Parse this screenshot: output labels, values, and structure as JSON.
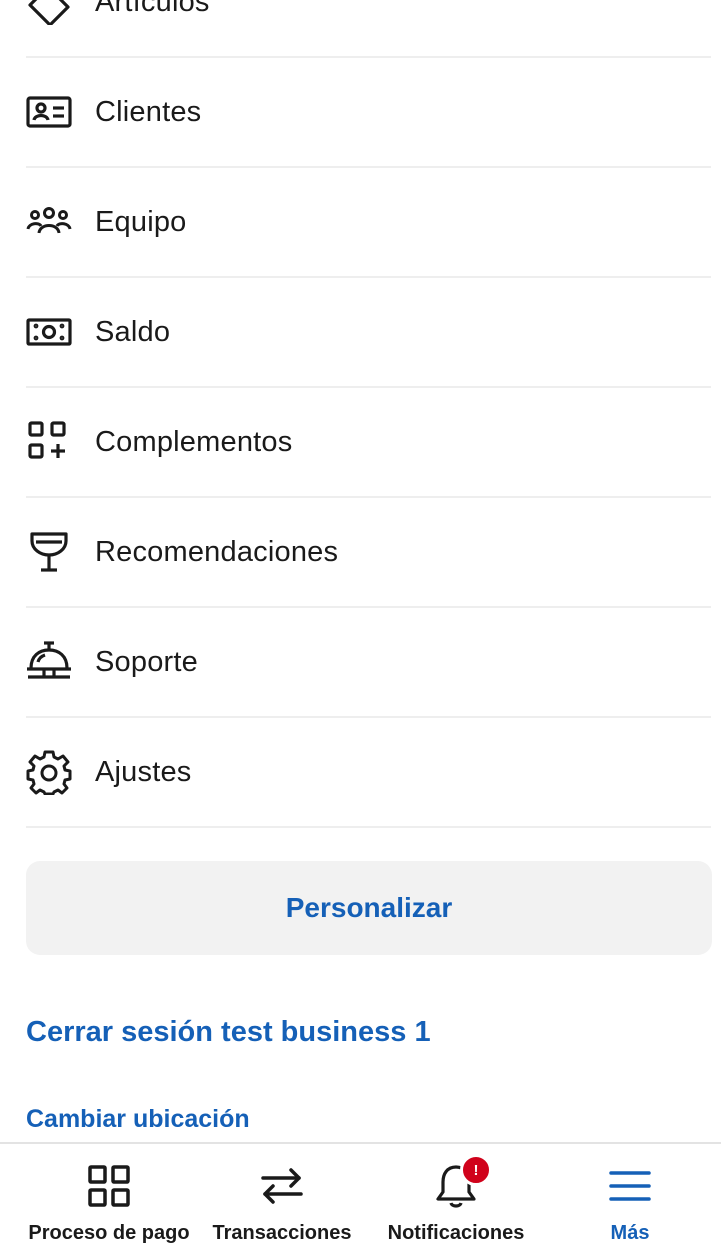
{
  "menu": {
    "items": [
      {
        "label": "Artículos",
        "icon": "tag-icon"
      },
      {
        "label": "Clientes",
        "icon": "contact-card-icon"
      },
      {
        "label": "Equipo",
        "icon": "team-icon"
      },
      {
        "label": "Saldo",
        "icon": "banknote-icon"
      },
      {
        "label": "Complementos",
        "icon": "add-ons-icon"
      },
      {
        "label": "Recomendaciones",
        "icon": "trophy-icon"
      },
      {
        "label": "Soporte",
        "icon": "service-bell-icon"
      },
      {
        "label": "Ajustes",
        "icon": "gear-icon"
      }
    ]
  },
  "actions": {
    "personalize_label": "Personalizar",
    "signout_label": "Cerrar sesión test business 1",
    "change_location_label": "Cambiar ubicación"
  },
  "tabbar": {
    "tabs": [
      {
        "label": "Proceso de pago",
        "icon": "grid-icon",
        "active": false
      },
      {
        "label": "Transacciones",
        "icon": "swap-arrows-icon",
        "active": false
      },
      {
        "label": "Notificaciones",
        "icon": "bell-icon",
        "active": false,
        "badge": "!"
      },
      {
        "label": "Más",
        "icon": "hamburger-icon",
        "active": true
      }
    ]
  },
  "colors": {
    "accent": "#1560b7",
    "badge": "#d0021b",
    "text": "#1a1a1a",
    "divider": "#eeeeee",
    "button_bg": "#f2f2f2"
  }
}
